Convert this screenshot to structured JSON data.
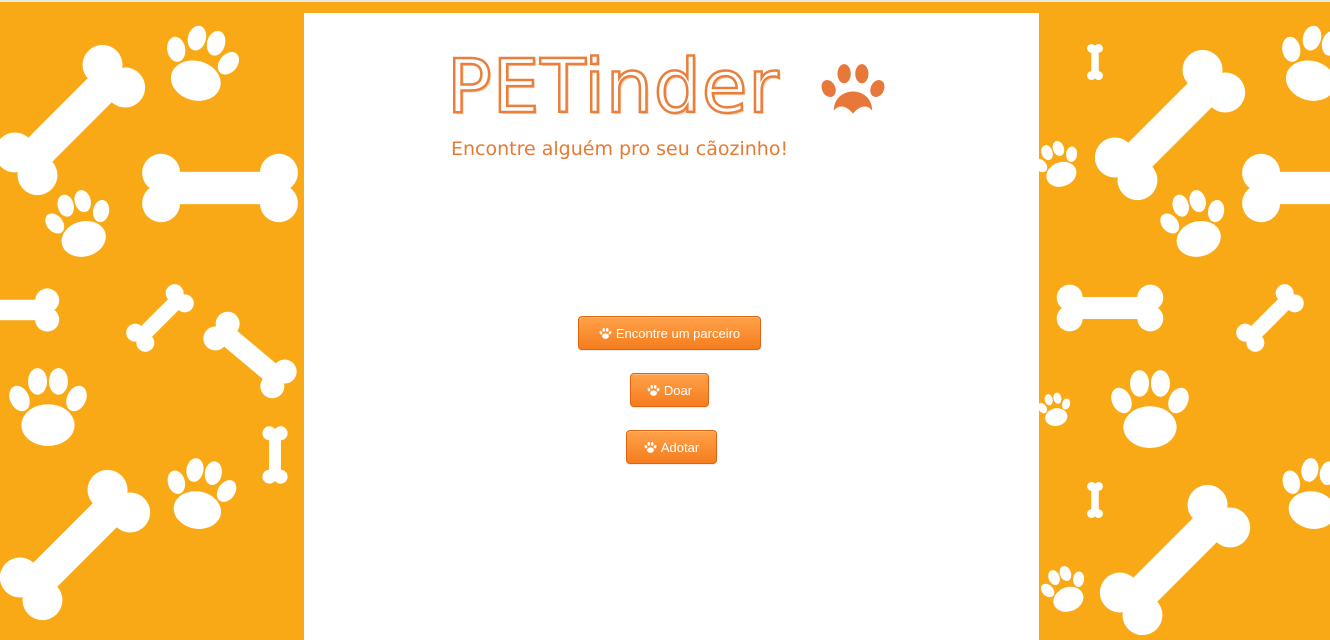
{
  "brand": {
    "title": "PETinder",
    "tagline": "Encontre alguém pro seu cãozinho!",
    "accent_color": "#ea7f3b",
    "background_color": "#f8a915",
    "logo_icon": "paw-icon"
  },
  "actions": [
    {
      "label": "Encontre um parceiro",
      "icon": "paw-icon"
    },
    {
      "label": "Doar",
      "icon": "paw-icon"
    },
    {
      "label": "Adotar",
      "icon": "paw-icon"
    }
  ],
  "background_pattern": {
    "motifs": [
      "bone-icon",
      "paw-icon"
    ]
  }
}
